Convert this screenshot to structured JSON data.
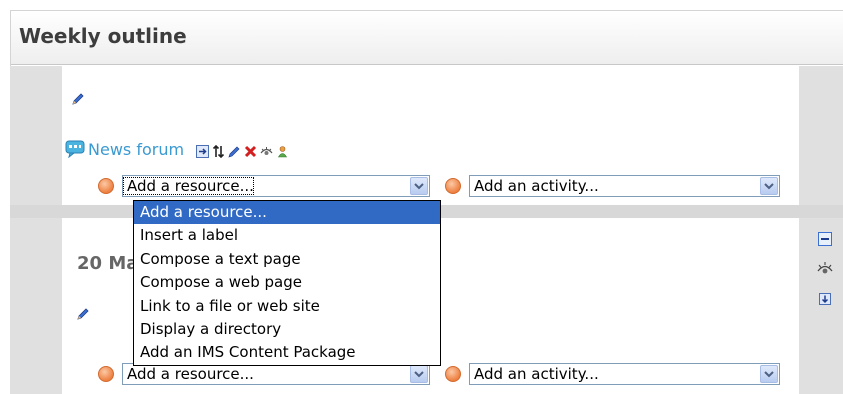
{
  "header": {
    "title": "Weekly outline"
  },
  "section0": {
    "news_forum_label": "News forum",
    "tool_icons": [
      "move-right-icon",
      "move-updown-icon",
      "edit-icon",
      "delete-icon",
      "hide-icon",
      "assign-roles-icon"
    ],
    "add_resource": {
      "value": "Add a resource...",
      "options": [
        "Add a resource...",
        "Insert a label",
        "Compose a text page",
        "Compose a web page",
        "Link to a file or web site",
        "Display a directory",
        "Add an IMS Content Package"
      ],
      "selected_index": 0
    },
    "add_activity": {
      "value": "Add an activity..."
    }
  },
  "section1": {
    "date_label": "20 Ma",
    "add_resource": {
      "value": "Add a resource..."
    },
    "add_activity": {
      "value": "Add an activity..."
    },
    "side_icons": [
      "collapse-icon",
      "eye-icon",
      "move-down-icon"
    ]
  },
  "colors": {
    "link": "#3a9ad1",
    "selection": "#316ac5",
    "side_panel": "#e0e0e0"
  }
}
